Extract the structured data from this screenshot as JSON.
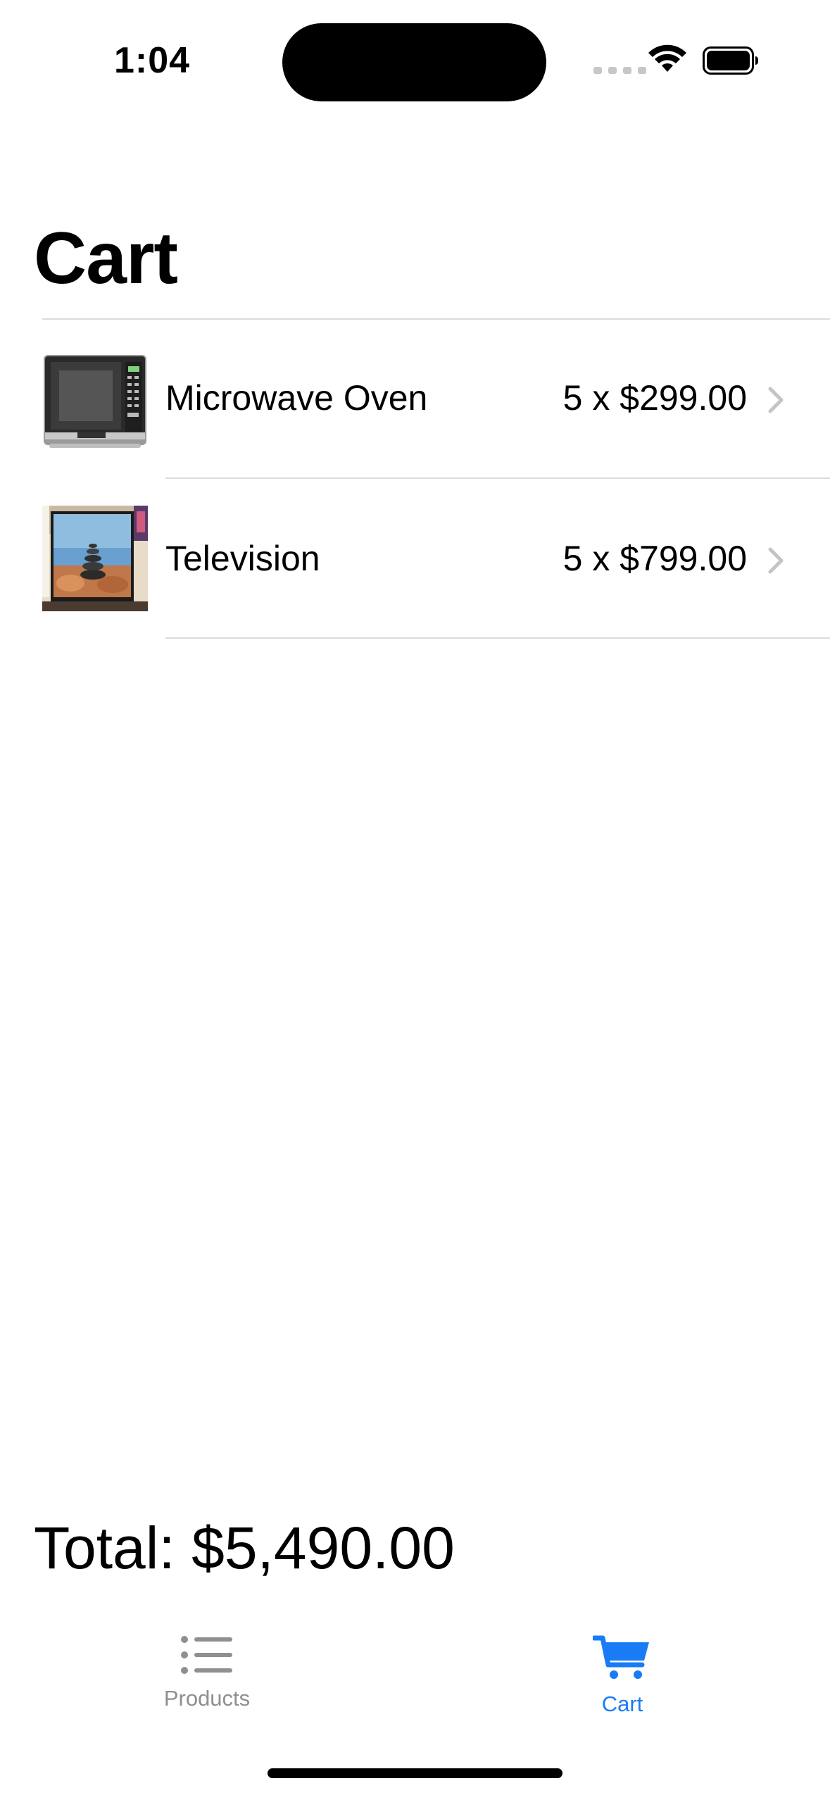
{
  "status_bar": {
    "time": "1:04"
  },
  "page": {
    "title": "Cart"
  },
  "cart": {
    "items": [
      {
        "name": "Microwave Oven",
        "price": "5 x $299.00",
        "icon": "microwave-image"
      },
      {
        "name": "Television",
        "price": "5 x $799.00",
        "icon": "television-image"
      }
    ],
    "total": "Total: $5,490.00"
  },
  "tab_bar": {
    "tabs": [
      {
        "label": "Products",
        "icon": "list-icon",
        "active": false
      },
      {
        "label": "Cart",
        "icon": "cart-icon",
        "active": true
      }
    ]
  },
  "colors": {
    "accent": "#1a7cf5",
    "inactive": "#8e8e93",
    "separator": "#dcdcde"
  }
}
